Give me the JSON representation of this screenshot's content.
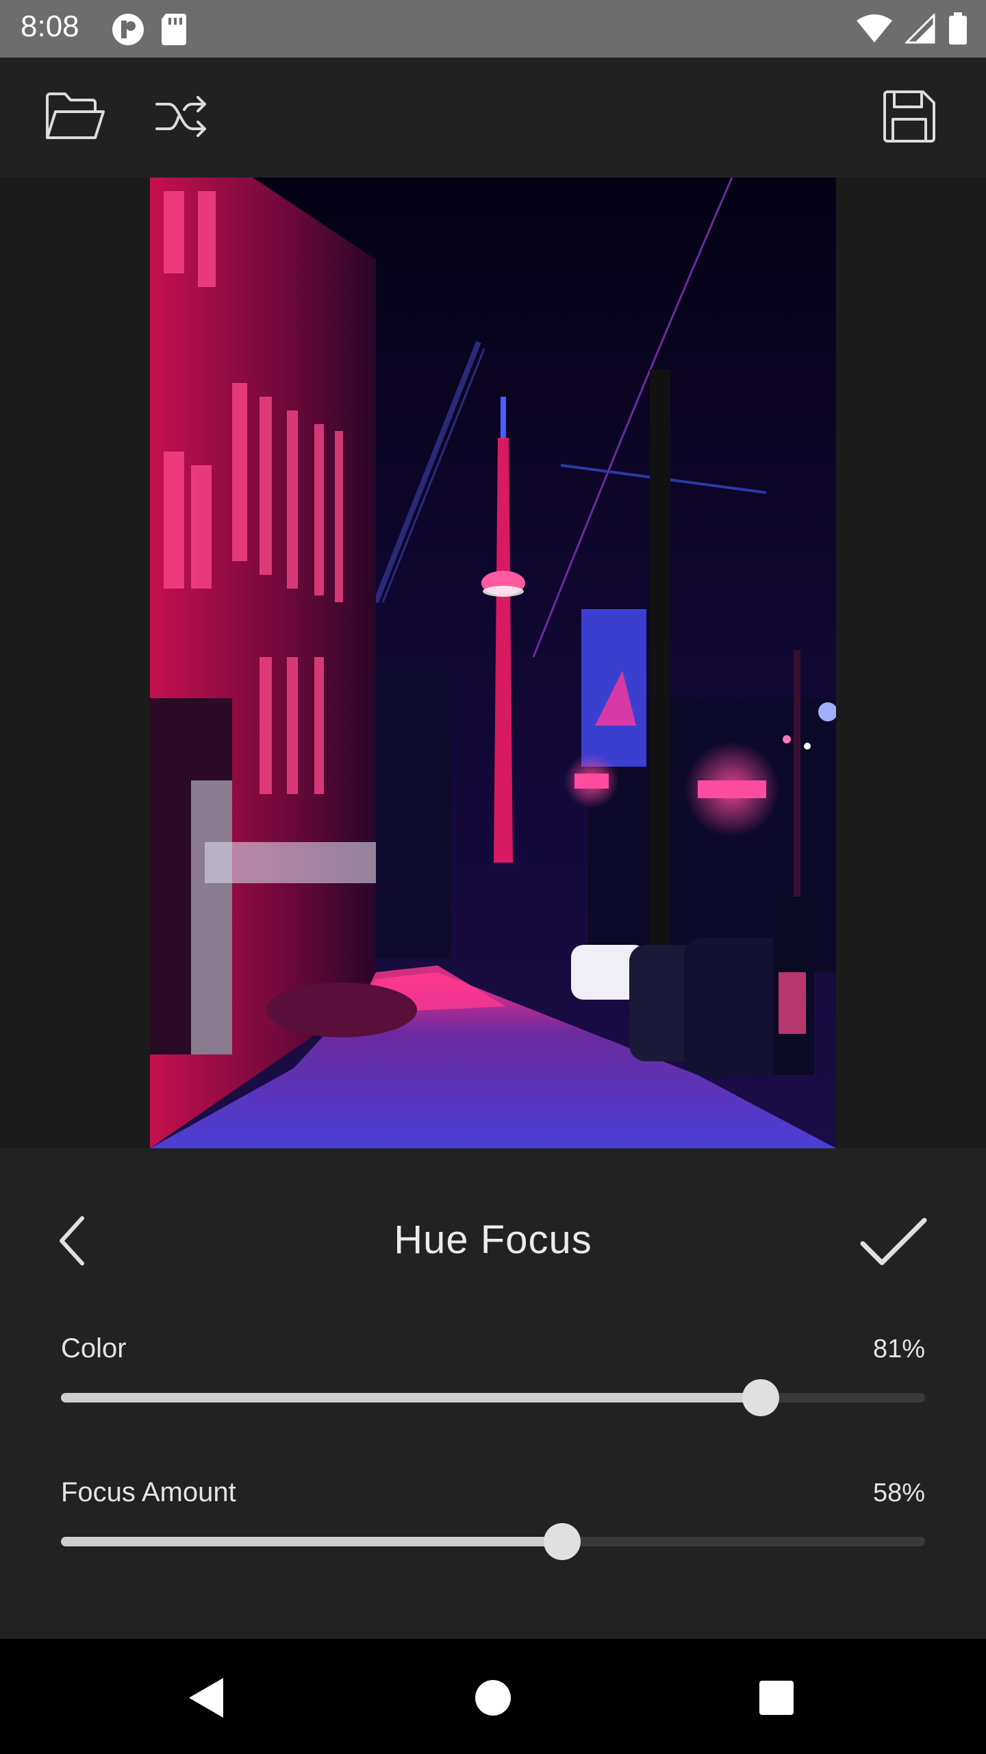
{
  "status_bar": {
    "time": "8:08",
    "left_icons": [
      "app-notification-icon",
      "sd-card-icon"
    ],
    "right_icons": [
      "wifi-icon",
      "cell-signal-icon",
      "battery-icon"
    ]
  },
  "toolbar": {
    "open_icon": "folder-open-icon",
    "shuffle_icon": "shuffle-icon",
    "save_icon": "save-icon"
  },
  "panel": {
    "title": "Hue Focus",
    "back_icon": "chevron-left-icon",
    "apply_icon": "checkmark-icon",
    "sliders": [
      {
        "label": "Color",
        "value_text": "81%",
        "value": 0.81
      },
      {
        "label": "Focus Amount",
        "value_text": "58%",
        "value": 0.58
      }
    ]
  },
  "nav": {
    "back_icon": "nav-back-icon",
    "home_icon": "nav-home-icon",
    "recents_icon": "nav-recents-icon"
  },
  "colors": {
    "accent_neon": "#ff2e7a",
    "night_blue": "#120a3a",
    "slider_fill": "#cfcfcf"
  }
}
